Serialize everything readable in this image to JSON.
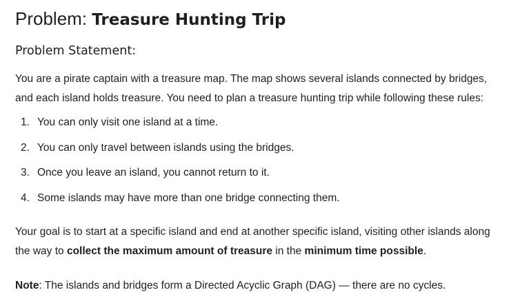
{
  "title": {
    "prefix": "Problem: ",
    "name": "Treasure Hunting Trip"
  },
  "section_heading": "Problem Statement:",
  "intro": {
    "line1": "You are a pirate captain with a treasure map. The map shows several islands connected by bridges,",
    "line2": "and each island holds treasure. You need to plan a treasure hunting trip while following these rules:"
  },
  "rules": [
    {
      "num": "1.",
      "text": "You can only visit one island at a time."
    },
    {
      "num": "2.",
      "text": "You can only travel between islands using the bridges."
    },
    {
      "num": "3.",
      "text": "Once you leave an island, you cannot return to it."
    },
    {
      "num": "4.",
      "text": "Some islands may have more than one bridge connecting them."
    }
  ],
  "goal": {
    "line1": "Your goal is to start at a specific island and end at another specific island, visiting other islands along",
    "line2_a": "the way to ",
    "line2_bold1": "collect the maximum amount of treasure",
    "line2_b": " in the ",
    "line2_bold2": "minimum time possible",
    "line2_c": "."
  },
  "note": {
    "label": "Note",
    "text": ": The islands and bridges form a Directed Acyclic Graph (DAG) — there are no cycles."
  }
}
